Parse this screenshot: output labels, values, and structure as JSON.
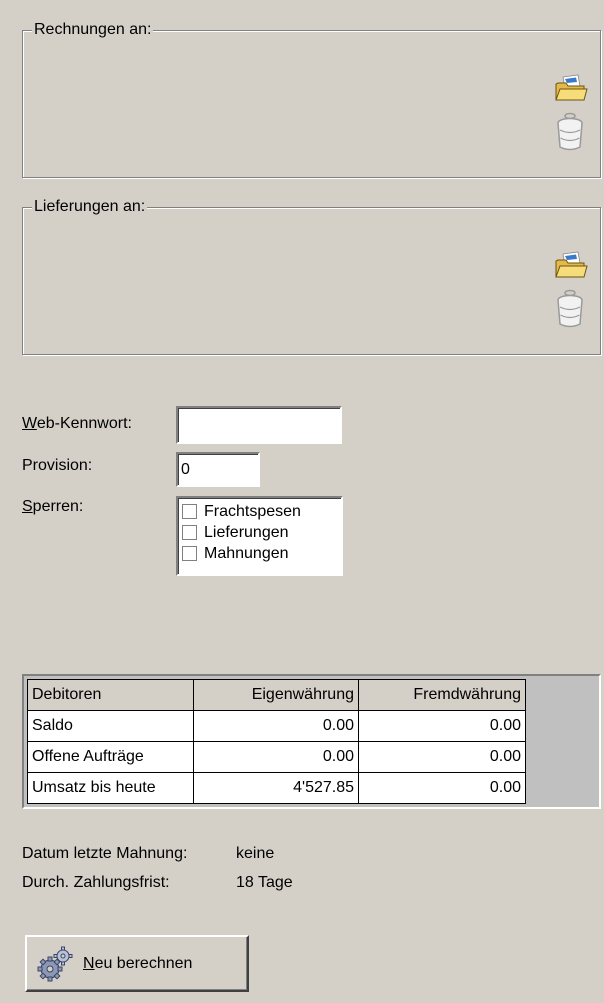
{
  "rechnungen": {
    "legend": "Rechnungen an:",
    "icons": [
      "open-folder-icon",
      "trash-icon"
    ]
  },
  "lieferungen": {
    "legend": "Lieferungen an:",
    "icons": [
      "open-folder-icon",
      "trash-icon"
    ]
  },
  "form": {
    "web_kennwort_prefix": "W",
    "web_kennwort_rest": "eb-Kennwort:",
    "web_kennwort_value": "",
    "provision_label": "Provision:",
    "provision_value": "0",
    "sperren_prefix": "S",
    "sperren_rest": "perren:",
    "sperren_options": [
      {
        "label": "Frachtspesen",
        "checked": false
      },
      {
        "label": "Lieferungen",
        "checked": false
      },
      {
        "label": "Mahnungen",
        "checked": false
      }
    ]
  },
  "debitoren_table": {
    "headers": [
      "Debitoren",
      "Eigenwährung",
      "Fremdwährung"
    ],
    "rows": [
      [
        "Saldo",
        "0.00",
        "0.00"
      ],
      [
        "Offene Aufträge",
        "0.00",
        "0.00"
      ],
      [
        "Umsatz bis heute",
        "4'527.85",
        "0.00"
      ]
    ]
  },
  "info": {
    "last_reminder_label": "Datum letzte Mahnung:",
    "last_reminder_value": "keine",
    "avg_payment_label": "Durch. Zahlungsfrist:",
    "avg_payment_value": "18 Tage"
  },
  "recalc_button": {
    "prefix": "N",
    "rest": "eu berechnen",
    "icon": "gears-icon"
  }
}
